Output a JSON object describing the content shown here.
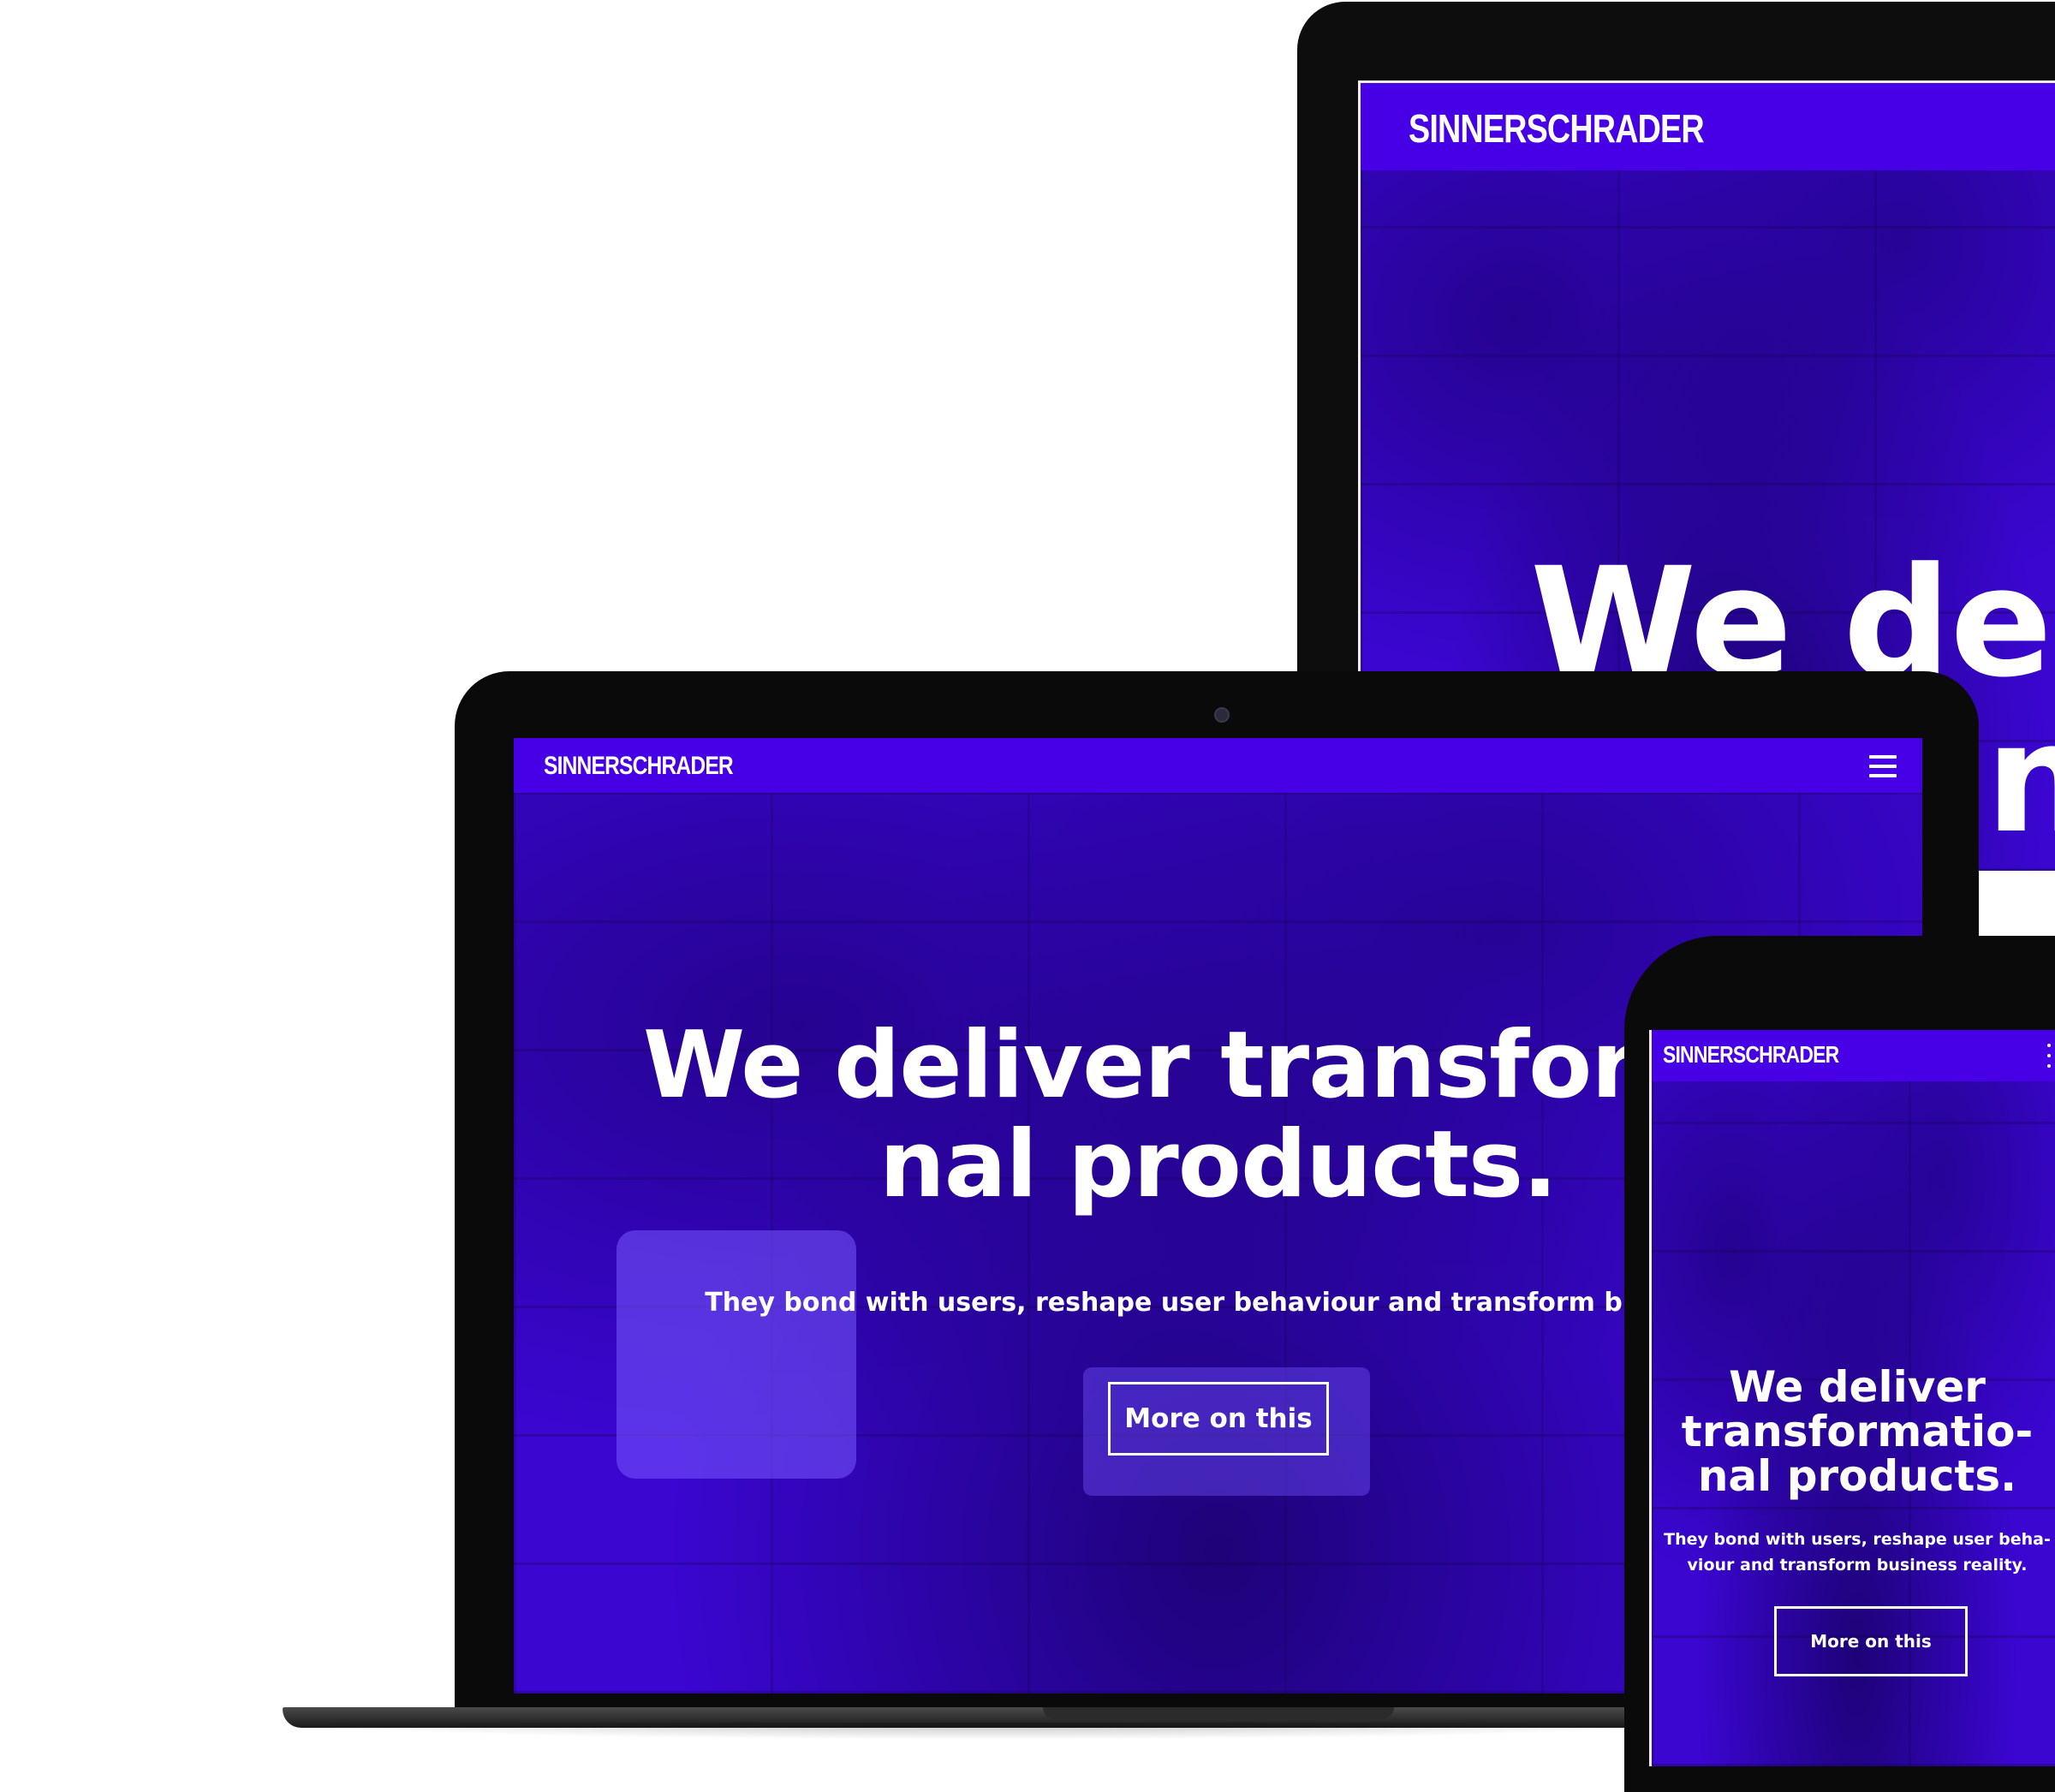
{
  "monitor": {
    "logo": "SINNERSCHRADER",
    "headline_line1": "We deli",
    "headline_line2": "n"
  },
  "laptop": {
    "logo": "SINNERSCHRADER",
    "menu_icon": "hamburger-menu-icon",
    "headline_line1": "We deliver transforma",
    "headline_line2": "nal products.",
    "subline": "They bond with users, reshape user behaviour and transform business",
    "cta_label": "More on this"
  },
  "phone": {
    "logo": "SINNERSCHRADER",
    "menu_icon": "kebab-menu-icon",
    "headline_line1": "We deliver",
    "headline_line2": "transformatio-",
    "headline_line3": "nal products.",
    "subline_line1": "They bond with users, reshape user beha-",
    "subline_line2": "viour and transform business reality.",
    "cta_label": "More on this"
  },
  "colors": {
    "brand_purple": "#4700e6",
    "hero_purple": "#3a06d0",
    "device_black": "#0a0a0a"
  }
}
